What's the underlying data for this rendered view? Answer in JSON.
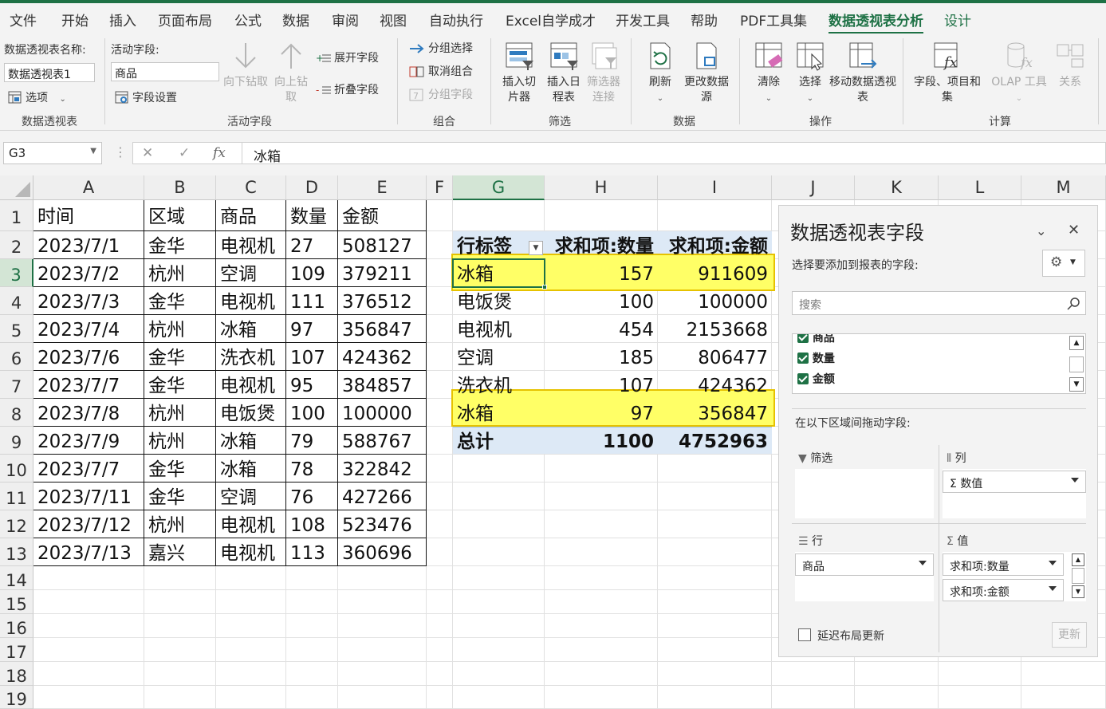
{
  "ribbon_tabs": [
    "文件",
    "开始",
    "插入",
    "页面布局",
    "公式",
    "数据",
    "审阅",
    "视图",
    "自动执行",
    "Excel自学成才",
    "开发工具",
    "帮助",
    "PDF工具集",
    "数据透视表分析",
    "设计"
  ],
  "active_tab": "数据透视表分析",
  "ribbon": {
    "pivot": {
      "name_label": "数据透视表名称:",
      "name_value": "数据透视表1",
      "options_label": "选项",
      "group_label": "数据透视表"
    },
    "active_field": {
      "label": "活动字段:",
      "value": "商品",
      "field_settings": "字段设置",
      "drill_down": "向下钻取",
      "drill_up": "向上钻取",
      "expand_field": "展开字段",
      "collapse_field": "折叠字段",
      "group_label": "活动字段"
    },
    "group": {
      "group_selection": "分组选择",
      "ungroup": "取消组合",
      "group_field": "分组字段",
      "group_label": "组合"
    },
    "filter": {
      "insert_slicer": "插入切片器",
      "insert_timeline": "插入日程表",
      "filter_connections": "筛选器连接",
      "group_label": "筛选"
    },
    "data": {
      "refresh": "刷新",
      "change_source": "更改数据源",
      "group_label": "数据"
    },
    "actions": {
      "clear": "清除",
      "select": "选择",
      "move": "移动数据透视表",
      "group_label": "操作"
    },
    "calc": {
      "fields_items": "字段、项目和集",
      "olap": "OLAP 工具",
      "relations": "关系",
      "group_label": "计算"
    }
  },
  "formula_bar": {
    "name_box": "G3",
    "formula": "冰箱"
  },
  "columns": [
    "A",
    "B",
    "C",
    "D",
    "E",
    "F",
    "G",
    "H",
    "I",
    "J",
    "K",
    "L",
    "M"
  ],
  "rows": [
    "1",
    "2",
    "3",
    "4",
    "5",
    "6",
    "7",
    "8",
    "9",
    "10",
    "11",
    "12",
    "13",
    "14",
    "15",
    "16",
    "17",
    "18",
    "19"
  ],
  "source_table": {
    "headers": [
      "时间",
      "区域",
      "商品",
      "数量",
      "金额"
    ],
    "rows": [
      [
        "2023/7/1",
        "金华",
        "电视机",
        "27",
        "508127"
      ],
      [
        "2023/7/2",
        "杭州",
        "空调",
        "109",
        "379211"
      ],
      [
        "2023/7/3",
        "金华",
        "电视机",
        "111",
        "376512"
      ],
      [
        "2023/7/4",
        "杭州",
        "冰箱",
        "97",
        "356847"
      ],
      [
        "2023/7/6",
        "金华",
        "洗衣机",
        "107",
        "424362"
      ],
      [
        "2023/7/7",
        "金华",
        "电视机",
        "95",
        "384857"
      ],
      [
        "2023/7/8",
        "杭州",
        "电饭煲",
        "100",
        "100000"
      ],
      [
        "2023/7/9",
        "杭州",
        "冰箱",
        "79",
        "588767"
      ],
      [
        "2023/7/7",
        "金华",
        "冰箱",
        "78",
        "322842"
      ],
      [
        "2023/7/11",
        "金华",
        "空调",
        "76",
        "427266"
      ],
      [
        "2023/7/12",
        "杭州",
        "电视机",
        "108",
        "523476"
      ],
      [
        "2023/7/13",
        "嘉兴",
        "电视机",
        "113",
        "360696"
      ]
    ]
  },
  "pivot_table": {
    "headers": [
      "行标签",
      "求和项:数量",
      "求和项:金额"
    ],
    "rows": [
      [
        "冰箱",
        "157",
        "911609"
      ],
      [
        "电饭煲",
        "100",
        "100000"
      ],
      [
        "电视机",
        "454",
        "2153668"
      ],
      [
        "空调",
        "185",
        "806477"
      ],
      [
        "洗衣机",
        "107",
        "424362"
      ],
      [
        "冰箱",
        "97",
        "356847"
      ]
    ],
    "total": [
      "总计",
      "1100",
      "4752963"
    ],
    "highlight_color": "#ffff66",
    "header_fill": "#dde9f6"
  },
  "field_pane": {
    "title": "数据透视表字段",
    "choose_label": "选择要添加到报表的字段:",
    "search_placeholder": "搜索",
    "fields": [
      "商品",
      "数量",
      "金额"
    ],
    "drag_label": "在以下区域间拖动字段:",
    "filters_label": "筛选",
    "columns_label": "列",
    "rows_label": "行",
    "values_label": "值",
    "columns_items": [
      "数值"
    ],
    "rows_items": [
      "商品"
    ],
    "values_items": [
      "求和项:数量",
      "求和项:金额"
    ],
    "defer_label": "延迟布局更新",
    "update_label": "更新"
  },
  "colors": {
    "accent": "#1e7145",
    "highlight": "#ffff66",
    "highlight_border": "#e6c200"
  }
}
